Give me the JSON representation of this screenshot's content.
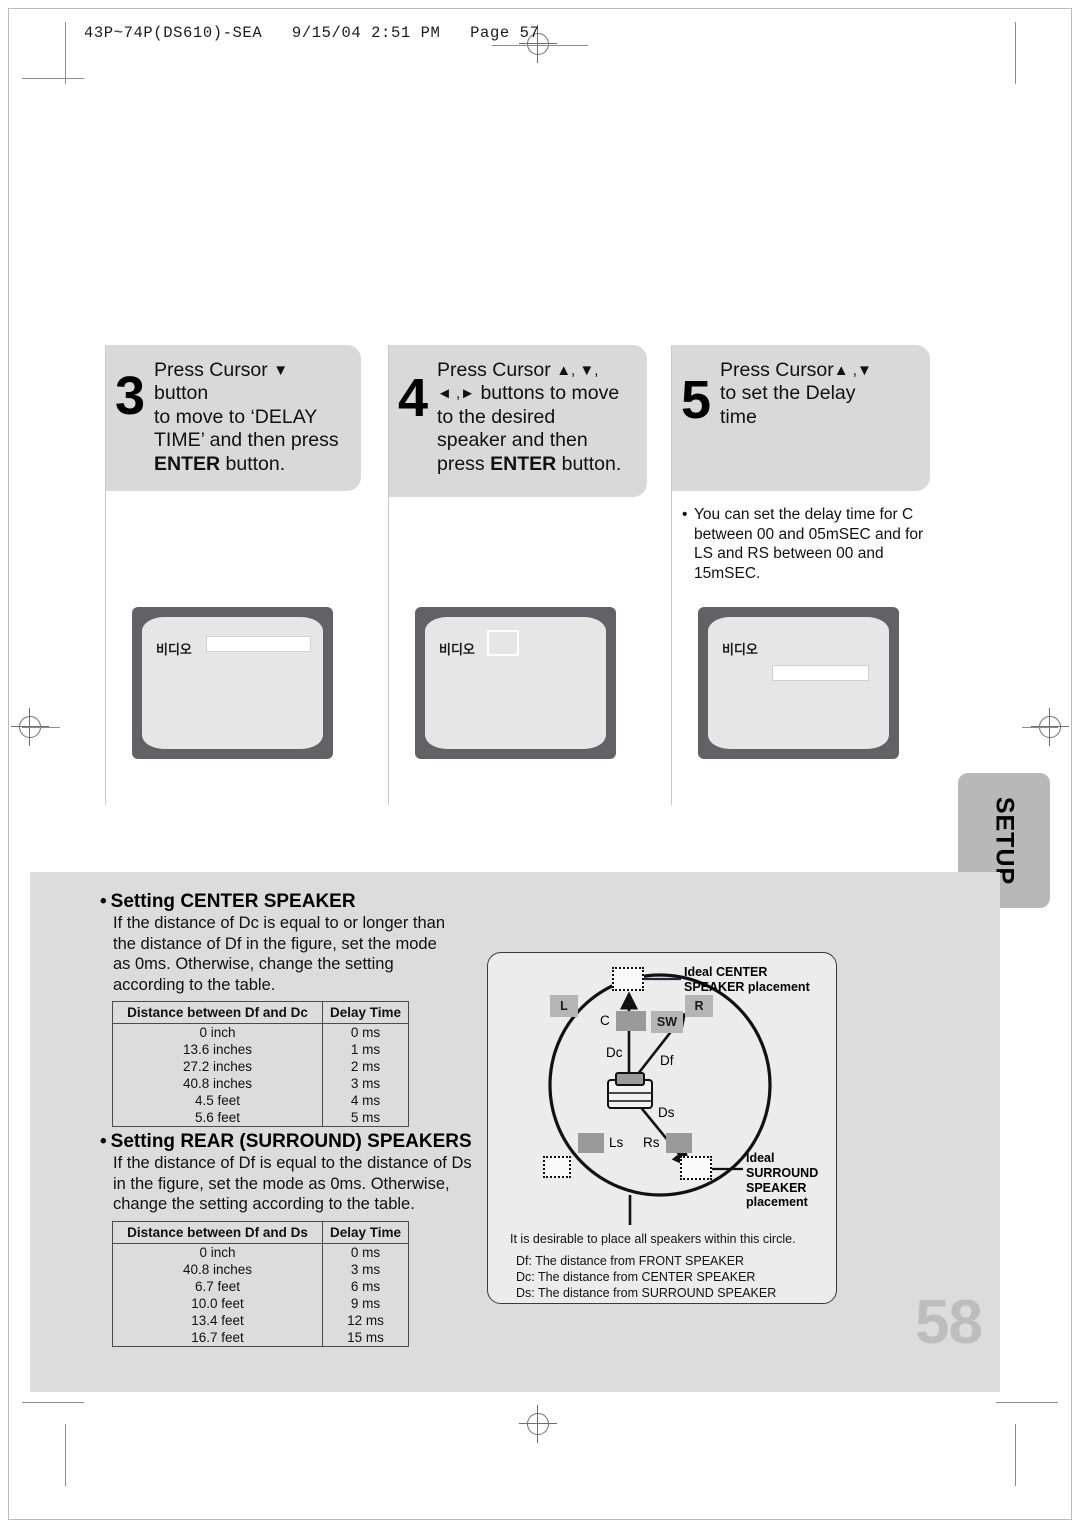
{
  "header": {
    "slug": "43P~74P(DS610)-SEA   9/15/04 2:51 PM   Page 57"
  },
  "steps": [
    {
      "number": "3",
      "line1_pre": "Press Cursor ",
      "line1_icon": "▼",
      "line1_post": " button",
      "line2": "to move to ‘DELAY",
      "line3": "TIME’ and then press",
      "line4_bold": "ENTER",
      "line4_post": " button.",
      "tv": {
        "label": "비디오",
        "indicator": "wide-bar"
      }
    },
    {
      "number": "4",
      "line1_pre": "Press Cursor ",
      "line1_icon": "▲, ▼,",
      "line2_icon": "◄ ,►",
      "line2_post": " buttons to move",
      "line3": "to the desired",
      "line4": "speaker and then",
      "line5_pre": "press ",
      "line5_bold": "ENTER",
      "line5_post": " button.",
      "tv": {
        "label": "비디오",
        "indicator": "small-box"
      }
    },
    {
      "number": "5",
      "line1_pre": "Press Cursor",
      "line1_icon": "▲ ,▼",
      "line2": "to set the Delay",
      "line3": "time",
      "tv": {
        "label": "비디오",
        "indicator": "wide-bar"
      }
    }
  ],
  "note": {
    "bullet": "•",
    "text": "You can set the delay time for C between 00 and 05mSEC and for LS and RS between 00 and 15mSEC."
  },
  "setup_tab": {
    "label": "SETUP"
  },
  "center_section": {
    "bullet": "•",
    "title": "Setting CENTER SPEAKER",
    "body": "If the distance of Dc is equal to or longer than the distance of Df in the figure, set the mode as 0ms. Otherwise, change the setting according to the table."
  },
  "rear_section": {
    "bullet": "•",
    "title": "Setting REAR (SURROUND) SPEAKERS",
    "body": "If the distance of Df is equal to the distance of Ds in the figure, set the mode as 0ms. Otherwise, change the setting according to the table."
  },
  "table_center": {
    "headers": [
      "Distance between Df and Dc",
      "Delay Time"
    ],
    "rows": [
      [
        "0 inch",
        "0 ms"
      ],
      [
        "13.6 inches",
        "1 ms"
      ],
      [
        "27.2 inches",
        "2 ms"
      ],
      [
        "40.8 inches",
        "3 ms"
      ],
      [
        "4.5 feet",
        "4 ms"
      ],
      [
        "5.6 feet",
        "5 ms"
      ]
    ]
  },
  "table_rear": {
    "headers": [
      "Distance between Df and Ds",
      "Delay Time"
    ],
    "rows": [
      [
        "0 inch",
        "0 ms"
      ],
      [
        "40.8 inches",
        "3 ms"
      ],
      [
        "6.7 feet",
        "6 ms"
      ],
      [
        "10.0 feet",
        "9 ms"
      ],
      [
        "13.4 feet",
        "12 ms"
      ],
      [
        "16.7 feet",
        "15 ms"
      ]
    ]
  },
  "diagram": {
    "ideal_center_label_line1": "Ideal CENTER",
    "ideal_center_label_line2": "SPEAKER placement",
    "ideal_surround_label_line1": "Ideal",
    "ideal_surround_label_line2": "SURROUND",
    "ideal_surround_label_line3": "SPEAKER",
    "ideal_surround_label_line4": "placement",
    "speakers": [
      {
        "id": "L",
        "label": "L"
      },
      {
        "id": "R",
        "label": "R"
      },
      {
        "id": "C",
        "label": "C"
      },
      {
        "id": "SW",
        "label": "SW"
      },
      {
        "id": "Ls",
        "label": "Ls"
      },
      {
        "id": "Rs",
        "label": "Rs"
      }
    ],
    "distances": [
      {
        "id": "Dc",
        "label": "Dc"
      },
      {
        "id": "Df",
        "label": "Df"
      },
      {
        "id": "Ds",
        "label": "Ds"
      }
    ],
    "caption_circle": "It is desirable to place all speakers within this circle.",
    "caption_df": "Df: The distance from FRONT SPEAKER",
    "caption_dc": "Dc: The distance from CENTER SPEAKER",
    "caption_ds": "Ds: The distance from SURROUND SPEAKER"
  },
  "page_number": "58"
}
